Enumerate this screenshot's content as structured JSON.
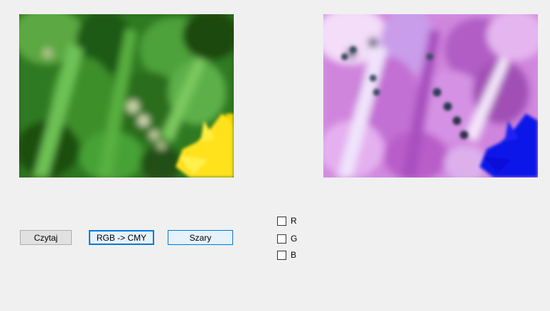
{
  "buttons": {
    "read_label": "Czytaj",
    "convert_label": "RGB -> CMY",
    "gray_label": "Szary"
  },
  "checkboxes": [
    {
      "label": "R",
      "checked": false
    },
    {
      "label": "G",
      "checked": false
    },
    {
      "label": "B",
      "checked": false
    }
  ],
  "images": {
    "original_icon": "grass-flower-photo",
    "converted_icon": "inverted-cmy-photo"
  },
  "colors": {
    "background": "#f0f0f0",
    "focus_accent": "#0078d7"
  }
}
